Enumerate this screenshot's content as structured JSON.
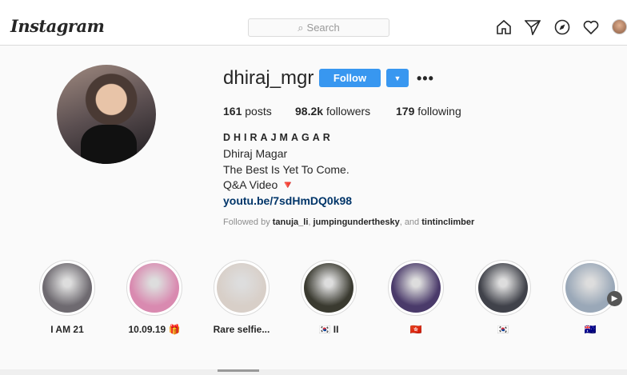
{
  "header": {
    "logo": "Instagram",
    "search_placeholder": "Search"
  },
  "profile": {
    "username": "dhiraj_mgr",
    "follow_label": "Follow",
    "posts": "161",
    "posts_label": "posts",
    "followers": "98.2k",
    "followers_label": "followers",
    "following": "179",
    "following_label": "following",
    "display_name": "DHIRAJMAGAR",
    "name": "Dhiraj Magar",
    "bio_line": "The Best Is Yet To Come.",
    "bio_line2": "Q&A Video",
    "bio_emoji": "🔻",
    "link": "youtu.be/7sdHmDQ0k98",
    "followed_by_prefix": "Followed by",
    "followed_by": [
      "tanuja_li",
      "jumpingunderthesky",
      "tintinclimber"
    ],
    "followed_sep": ", ",
    "followed_and": ", and"
  },
  "highlights": [
    {
      "label": "I AM 21",
      "color": "#6e6a70"
    },
    {
      "label": "10.09.19 🎁",
      "color": "#d98ab0"
    },
    {
      "label": "Rare selfie...",
      "color": "#d8cfc8"
    },
    {
      "label": "🇰🇷 II",
      "color": "#3a3a30"
    },
    {
      "label": "🇭🇰",
      "color": "#4a3a6a"
    },
    {
      "label": "🇰🇷",
      "color": "#40424a"
    },
    {
      "label": "🇦🇺",
      "color": "#9aa8b8"
    }
  ]
}
